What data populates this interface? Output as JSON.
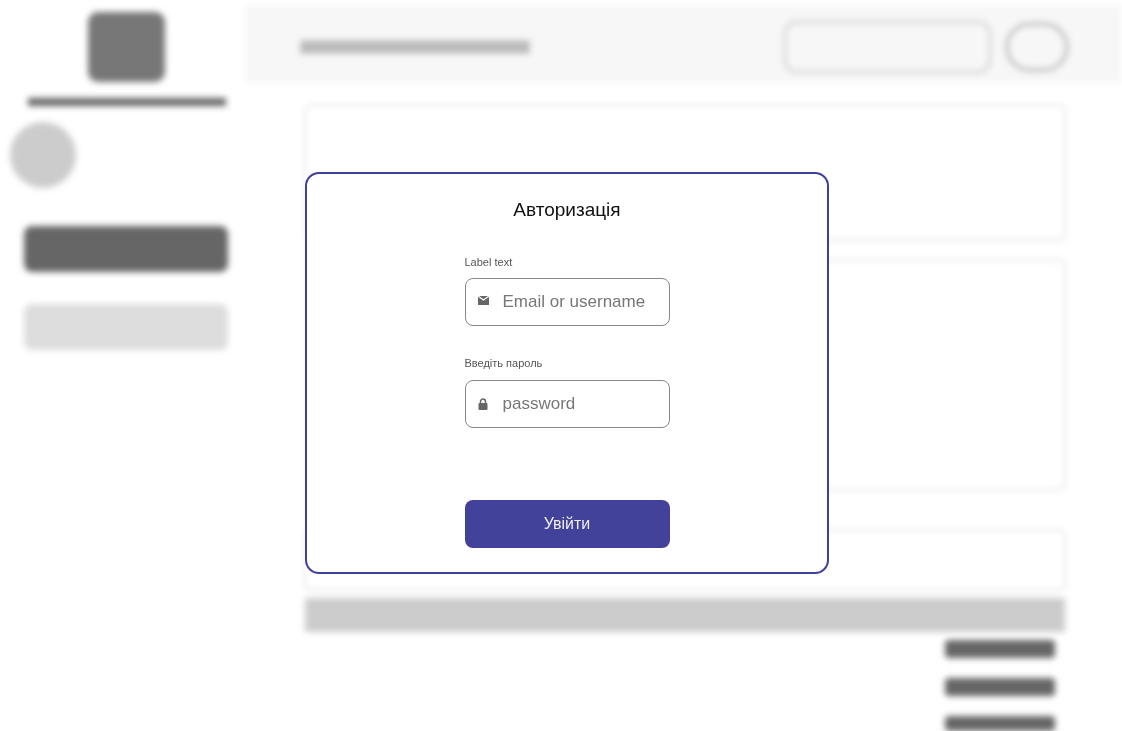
{
  "dialog": {
    "title": "Авторизація",
    "fields": [
      {
        "kind": "email",
        "label": "Label text",
        "placeholder": "Email or username"
      },
      {
        "kind": "password",
        "label": "Введіть пароль",
        "placeholder": "password"
      }
    ],
    "submit": "Увійти"
  }
}
